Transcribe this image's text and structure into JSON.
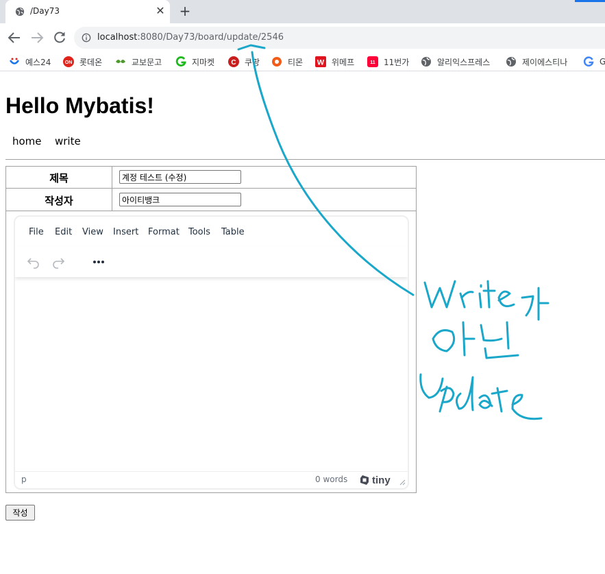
{
  "browser": {
    "tab_title": "/Day73",
    "url_host": "localhost",
    "url_rest": ":8080/Day73/board/update/2546"
  },
  "bookmarks": [
    {
      "label": "예스24",
      "icon": "yes24-icon",
      "color": "#1a73e8"
    },
    {
      "label": "롯데온",
      "icon": "lotteon-icon",
      "color": "#e0241b"
    },
    {
      "label": "교보문고",
      "icon": "kyobo-icon",
      "color": "#4c9a2a"
    },
    {
      "label": "지마켓",
      "icon": "gmarket-icon",
      "color": "#1db91d"
    },
    {
      "label": "쿠팡",
      "icon": "coupang-icon",
      "color": "#c81e1e"
    },
    {
      "label": "티몬",
      "icon": "tmon-icon",
      "color": "#f25c19"
    },
    {
      "label": "위메프",
      "icon": "wemakeprice-icon",
      "color": "#e0141e"
    },
    {
      "label": "11번가",
      "icon": "11st-icon",
      "color": "#ff0038"
    },
    {
      "label": "알리익스프레스",
      "icon": "globe-icon",
      "color": "#5f6368"
    },
    {
      "label": "제이에스티나",
      "icon": "globe-icon",
      "color": "#5f6368"
    },
    {
      "label": "G",
      "icon": "google-icon",
      "color": "#4285f4"
    }
  ],
  "page": {
    "title": "Hello Mybatis!",
    "nav": [
      "home",
      "write"
    ]
  },
  "form": {
    "title_label": "제목",
    "title_value": "계정 테스트 (수정)",
    "author_label": "작성자",
    "author_value": "아이티뱅크",
    "submit_label": "작성"
  },
  "editor": {
    "menus": [
      "File",
      "Edit",
      "View",
      "Insert",
      "Format",
      "Tools",
      "Table"
    ],
    "status_path": "p",
    "word_count": "0 words",
    "brand": "tiny"
  },
  "annotation": {
    "color": "#1aa7c9",
    "text_lines": [
      "Write가",
      "아닌",
      "Update"
    ]
  }
}
